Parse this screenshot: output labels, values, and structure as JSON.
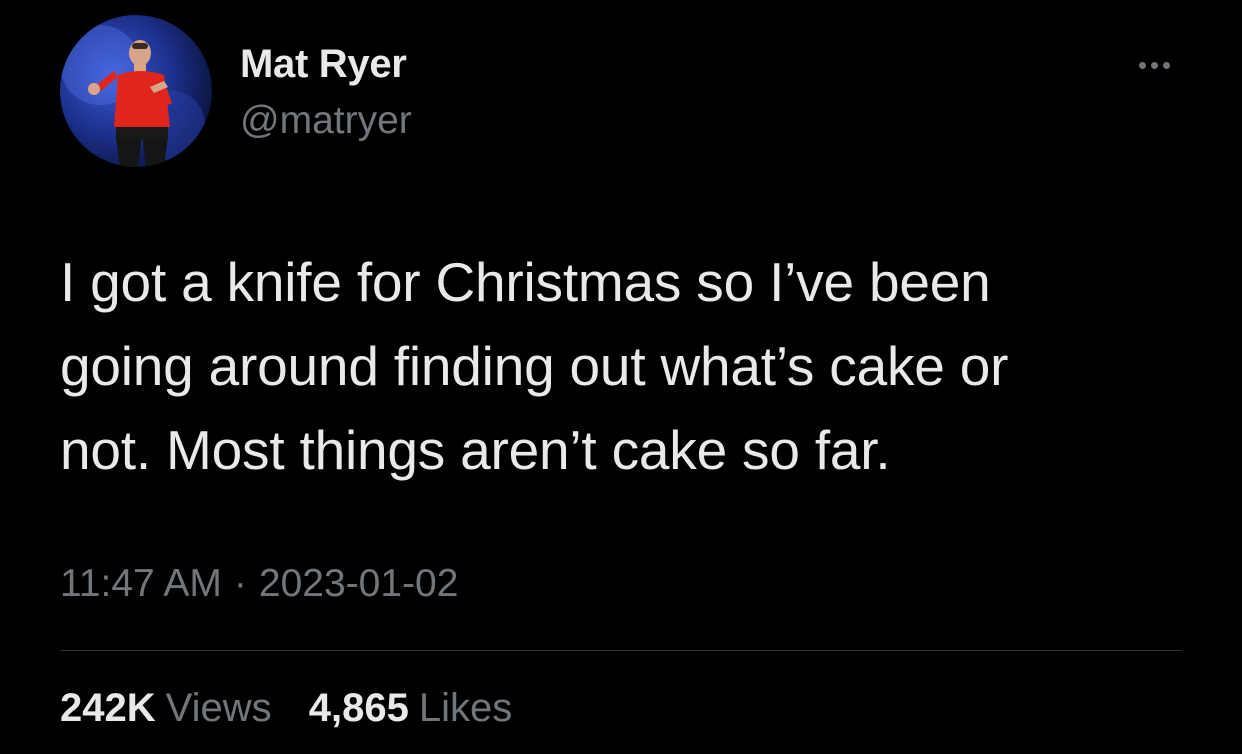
{
  "user": {
    "display_name": "Mat Ryer",
    "handle": "@matryer"
  },
  "tweet": {
    "text_lines": [
      "I got a knife for Christmas so I’ve been",
      "going around finding out what’s cake or",
      "not. Most things aren’t cake so far."
    ],
    "time": "11:47 AM",
    "separator": "·",
    "date": "2023-01-02"
  },
  "stats": {
    "views_count": "242K",
    "views_label": "Views",
    "likes_count": "4,865",
    "likes_label": "Likes"
  },
  "icons": {
    "more": "more-options-icon"
  },
  "colors": {
    "background": "#000000",
    "text_primary": "#e7e9ea",
    "text_secondary": "#71767b",
    "divider": "#2f3336"
  }
}
